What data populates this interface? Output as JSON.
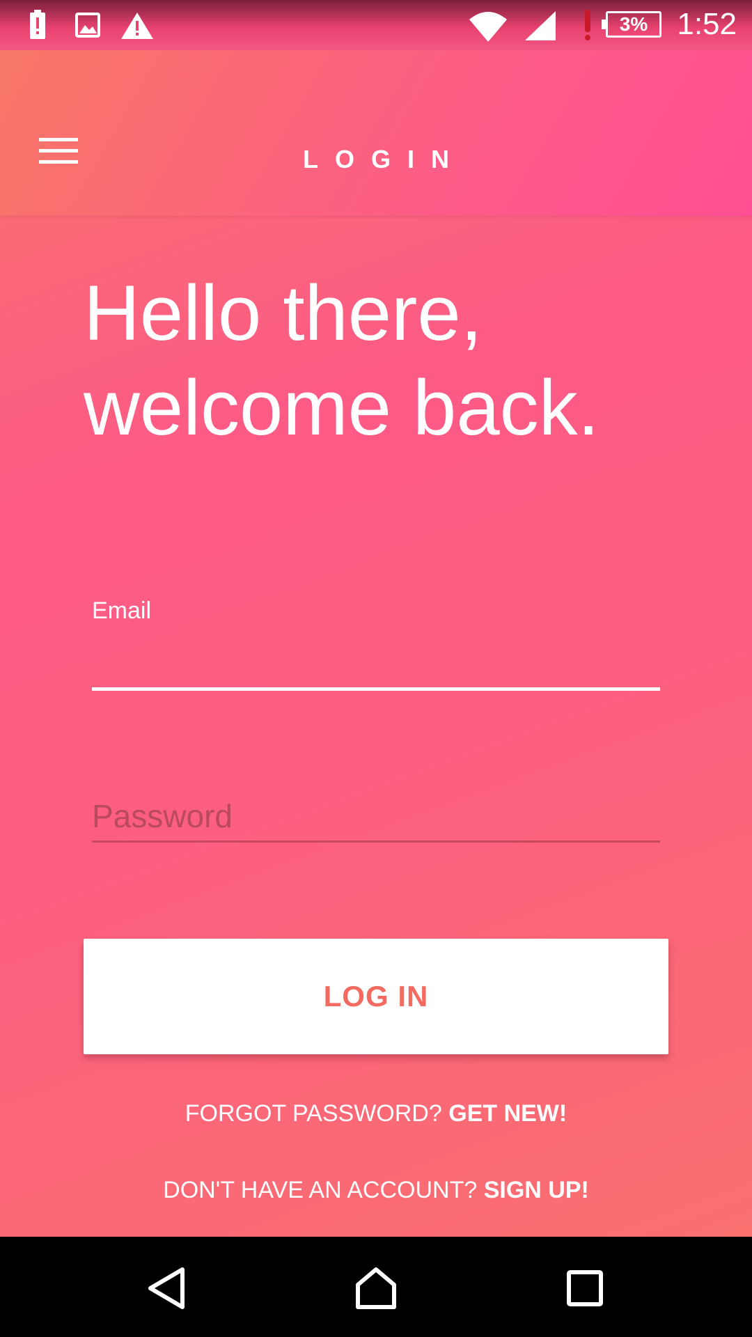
{
  "status_bar": {
    "time": "1:52",
    "battery_percent": "3%",
    "icons": [
      "battery-alert-icon",
      "image-icon",
      "warning-icon",
      "wifi-icon",
      "signal-icon",
      "red-alert-icon",
      "battery-icon"
    ]
  },
  "app_bar": {
    "title": "LOGIN",
    "menu_icon": "hamburger-menu-icon"
  },
  "greeting": {
    "line1": "Hello there,",
    "line2": "welcome back."
  },
  "form": {
    "email_label": "Email",
    "email_value": "",
    "password_placeholder": "Password",
    "password_value": "",
    "submit_label": "LOG IN"
  },
  "links": {
    "forgot_text": "FORGOT PASSWORD?",
    "forgot_action": "GET NEW!",
    "signup_text": "DON'T HAVE AN ACCOUNT?",
    "signup_action": "SIGN UP!"
  },
  "nav_bar": {
    "icons": [
      "back-icon",
      "home-icon",
      "recents-icon"
    ]
  },
  "colors": {
    "accent_text": "#f26a60",
    "gradient_start": "#f9756b",
    "gradient_end": "#ff4f93"
  }
}
